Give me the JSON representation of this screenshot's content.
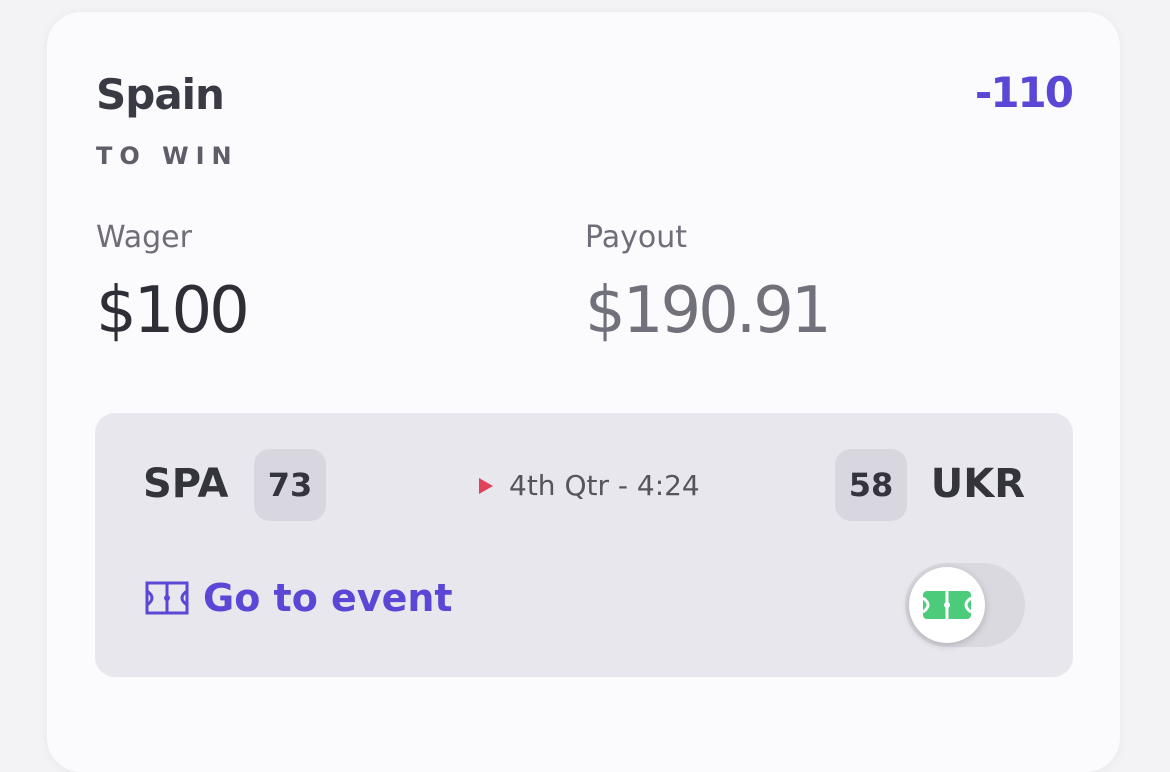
{
  "bet": {
    "team": "Spain",
    "type": "TO WIN",
    "odds": "-110",
    "wager_label": "Wager",
    "wager_value": "$100",
    "payout_label": "Payout",
    "payout_value": "$190.91"
  },
  "event": {
    "home": {
      "abbr": "SPA",
      "score": "73"
    },
    "away": {
      "abbr": "UKR",
      "score": "58"
    },
    "status": "4th Qtr - 4:24",
    "link_label": "Go to event",
    "court_view_toggle_on": false
  },
  "colors": {
    "accent": "#5b47d6",
    "live": "#e0415b",
    "court": "#4ccb7a"
  },
  "icons": {
    "live": "play-triangle-icon",
    "link": "court-icon",
    "toggle": "court-icon"
  }
}
